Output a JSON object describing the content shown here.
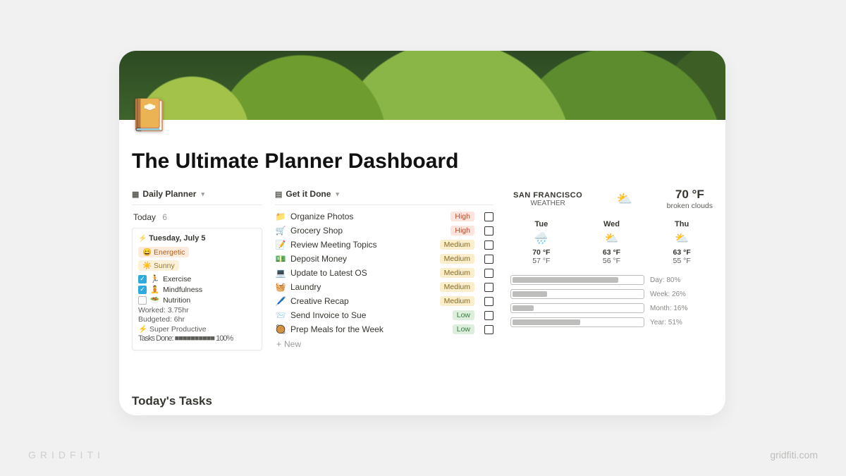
{
  "page": {
    "icon": "📔",
    "title": "The Ultimate Planner Dashboard",
    "section_today_tasks": "Today's Tasks"
  },
  "daily_planner": {
    "view_label": "Daily Planner",
    "group_label": "Today",
    "group_count": "6",
    "card": {
      "date": "Tuesday, July 5",
      "mood": "😄 Energetic",
      "weather": "☀️ Sunny",
      "habits": [
        {
          "emoji": "🏃",
          "name": "Exercise",
          "checked": true
        },
        {
          "emoji": "🧘",
          "name": "Mindfulness",
          "checked": true
        },
        {
          "emoji": "🥗",
          "name": "Nutrition",
          "checked": false
        }
      ],
      "worked": "Worked: 3.75hr",
      "budgeted": "Budgeted: 6hr",
      "super": "⚡ Super Productive",
      "done": "Tasks Done: ■■■■■■■■■■ 100%"
    }
  },
  "get_it_done": {
    "view_label": "Get it Done",
    "tasks": [
      {
        "emoji": "📁",
        "name": "Organize Photos",
        "tag": "High"
      },
      {
        "emoji": "🛒",
        "name": "Grocery Shop",
        "tag": "High"
      },
      {
        "emoji": "📝",
        "name": "Review Meeting Topics",
        "tag": "Medium"
      },
      {
        "emoji": "💵",
        "name": "Deposit Money",
        "tag": "Medium"
      },
      {
        "emoji": "💻",
        "name": "Update to Latest OS",
        "tag": "Medium"
      },
      {
        "emoji": "🧺",
        "name": "Laundry",
        "tag": "Medium"
      },
      {
        "emoji": "🖊️",
        "name": "Creative Recap",
        "tag": "Medium"
      },
      {
        "emoji": "📨",
        "name": "Send Invoice to Sue",
        "tag": "Low"
      },
      {
        "emoji": "🥘",
        "name": "Prep Meals for the Week",
        "tag": "Low"
      }
    ],
    "new_label": "New"
  },
  "weather": {
    "city": "SAN FRANCISCO",
    "subtitle": "WEATHER",
    "now_icon": "⛅",
    "now_temp": "70 °F",
    "now_desc": "broken clouds",
    "forecast": [
      {
        "day": "Tue",
        "icon": "🌧️",
        "hi": "70 °F",
        "lo": "57 °F"
      },
      {
        "day": "Wed",
        "icon": "⛅",
        "hi": "63 °F",
        "lo": "56 °F"
      },
      {
        "day": "Thu",
        "icon": "⛅",
        "hi": "63 °F",
        "lo": "55 °F"
      }
    ]
  },
  "progress": [
    {
      "label": "Day: 80%",
      "pct": 80
    },
    {
      "label": "Week: 26%",
      "pct": 26
    },
    {
      "label": "Month: 16%",
      "pct": 16
    },
    {
      "label": "Year: 51%",
      "pct": 51
    }
  ],
  "branding": {
    "left": "GRIDFITI",
    "right": "gridfiti.com"
  }
}
